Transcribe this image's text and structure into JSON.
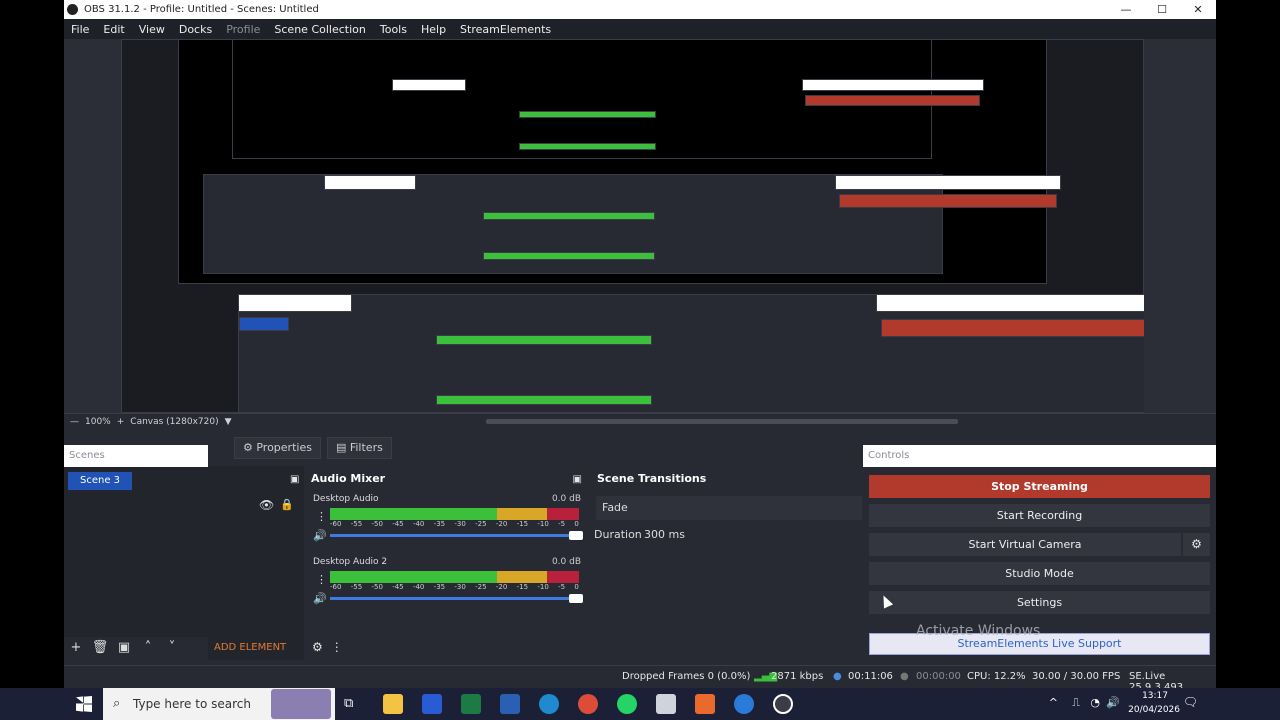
{
  "title": "OBS 31.1.2 - Profile: Untitled - Scenes: Untitled",
  "window_buttons": [
    "—",
    "☐",
    "✕"
  ],
  "menu": [
    "File",
    "Edit",
    "View",
    "Docks",
    "Profile",
    "Scene Collection",
    "Tools",
    "Help",
    "StreamElements"
  ],
  "zoom": {
    "level": "100%",
    "plus": "+",
    "canvas": "Canvas (1280x720)",
    "arrow": "▼"
  },
  "scenes": {
    "title": "Scenes",
    "items": [
      "Scene 3"
    ]
  },
  "source_buttons": {
    "properties": "Properties",
    "filters": "Filters"
  },
  "add_element": "ADD ELEMENT",
  "mixer": {
    "title": "Audio Mixer",
    "channels": [
      {
        "name": "Desktop Audio",
        "db": "0.0 dB"
      },
      {
        "name": "Desktop Audio 2",
        "db": "0.0 dB"
      }
    ],
    "ticks": [
      "-60",
      "-55",
      "-50",
      "-45",
      "-40",
      "-35",
      "-30",
      "-25",
      "-20",
      "-15",
      "-10",
      "-5",
      "0"
    ]
  },
  "transitions": {
    "title": "Scene Transitions",
    "type": "Fade",
    "duration_label": "Duration",
    "duration": "300 ms"
  },
  "controls": {
    "title": "Controls",
    "stop_streaming": "Stop Streaming",
    "start_recording": "Start Recording",
    "start_virtual_camera": "Start Virtual Camera",
    "studio_mode": "Studio Mode",
    "settings": "Settings",
    "support": "StreamElements Live Support"
  },
  "watermark": "Activate Windows",
  "status": {
    "dropped": "Dropped Frames 0 (0.0%)",
    "bitrate": "2871 kbps",
    "live_time": "00:11:06",
    "rec_time": "00:00:00",
    "cpu": "CPU: 12.2%",
    "fps": "30.00 / 30.00 FPS",
    "version": "SE.Live 25.9.3.493"
  },
  "taskbar": {
    "search": "Type here to search",
    "time": "13:17",
    "date": "20/04/2026"
  }
}
